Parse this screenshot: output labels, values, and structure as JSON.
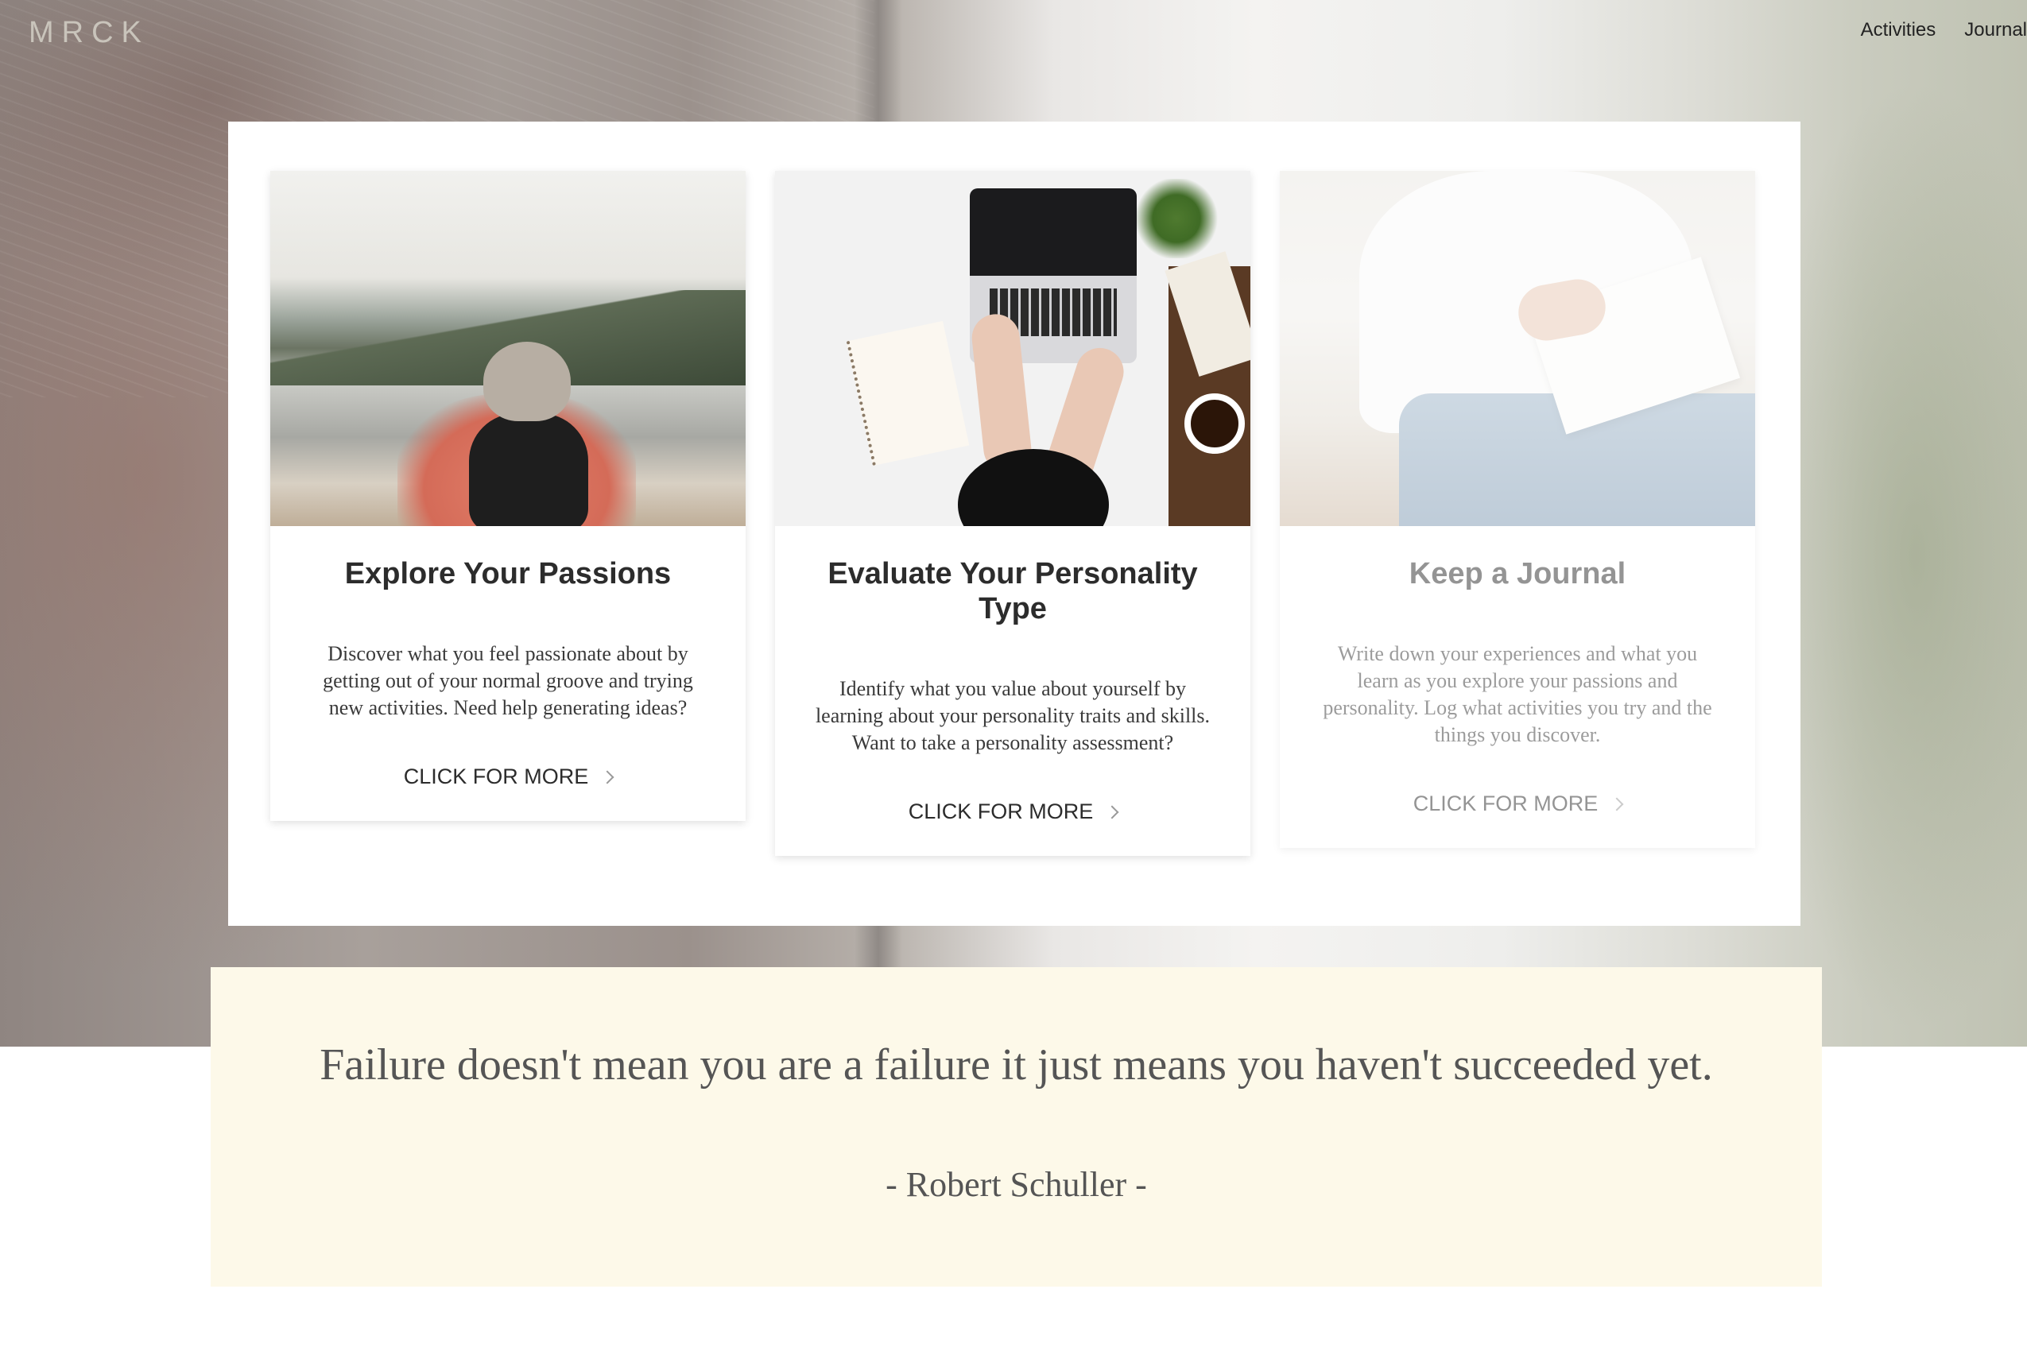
{
  "header": {
    "logo": "MRCK",
    "nav": [
      {
        "label": "Activities"
      },
      {
        "label": "Journal"
      }
    ]
  },
  "cards": [
    {
      "title": "Explore Your Passions",
      "text": "Discover what you feel passionate about by getting out of your normal groove and trying new activities. Need help generating ideas?",
      "cta": "CLICK FOR MORE"
    },
    {
      "title": "Evaluate Your Personality Type",
      "text": "Identify what you value about yourself by learning about your personality traits and skills. Want to take a personality assessment?",
      "cta": "CLICK FOR MORE"
    },
    {
      "title": "Keep a Journal",
      "text": "Write down your experiences and what you learn as you explore your passions and personality. Log what activities you try and the things you discover.",
      "cta": "CLICK FOR MORE"
    }
  ],
  "quote": {
    "text": "Failure doesn't mean you are a failure it just means you haven't succeeded yet.",
    "author": "- Robert Schuller -"
  },
  "icons": {
    "cta_arrow": "chevron-right-icon"
  },
  "colors": {
    "quote_background": "#fdf9e9",
    "text_dark": "#2c2c2c"
  }
}
